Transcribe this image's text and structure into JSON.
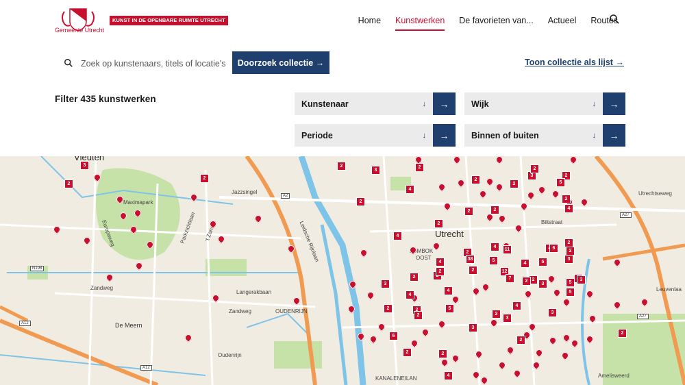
{
  "header": {
    "logo_text": "Gemeente Utrecht",
    "tagline": "KUNST IN DE OPENBARE RUIMTE UTRECHT",
    "nav": [
      {
        "label": "Home",
        "active": false
      },
      {
        "label": "Kunstwerken",
        "active": true
      },
      {
        "label": "De favorieten van...",
        "active": false
      },
      {
        "label": "Actueel",
        "active": false
      },
      {
        "label": "Routes",
        "active": false
      }
    ]
  },
  "search": {
    "placeholder": "Zoek op kunstenaars, titels of locatie's",
    "button_label": "Doorzoek collectie →",
    "list_link": "Toon collectie als lijst →"
  },
  "filters": {
    "title": "Filter 435 kunstwerken",
    "items": [
      {
        "label": "Kunstenaar"
      },
      {
        "label": "Wijk"
      },
      {
        "label": "Periode"
      },
      {
        "label": "Binnen of buiten"
      }
    ],
    "chevron": "↓",
    "go": "→"
  },
  "map": {
    "labels": {
      "vleuten": "Vleuten",
      "utrecht": "Utrecht",
      "demeern": "De Meern",
      "oudenrijn_caps": "OUDENRIJN",
      "oudenrijn": "Oudenrijn",
      "maximapark": "Maximapark",
      "lombok": "LOMBOK",
      "oost": "OOST",
      "kanaleneiland": "KANALENEILAN",
      "amelisweerd": "Amelisweerd",
      "leuvenlaan": "Leuvenlaa",
      "utrechtseweg": "Utrechtseweg",
      "biltstraat": "Biltstraat",
      "langerakbaan": "Langerakbaan",
      "zandweg": "Zandweg",
      "europaweg": "Europaweg",
      "parkzichtlaan": "Parkzichtlaan",
      "leidschrijnlaan": "Leidsche Rijnlaan",
      "jazzsingel": "Jazzsingel",
      "lalendorp": "'t Zand",
      "a2": "A2",
      "a12": "A12",
      "a27": "A27",
      "n198": "N198"
    },
    "clusters": [
      "3",
      "2",
      "2",
      "3",
      "2",
      "2",
      "2",
      "4",
      "2",
      "2",
      "4",
      "3",
      "2",
      "4",
      "2",
      "4",
      "3",
      "2",
      "2",
      "3",
      "2",
      "5",
      "2",
      "2",
      "2",
      "4",
      "38",
      "5",
      "12",
      "4",
      "2",
      "11",
      "4",
      "5",
      "2",
      "6",
      "2",
      "7",
      "3",
      "3",
      "4",
      "5",
      "2",
      "2",
      "3",
      "2",
      "2",
      "4",
      "2",
      "6",
      "2",
      "5",
      "2",
      "2",
      "4",
      "2",
      "2",
      "2",
      "2",
      "3",
      "3",
      "3",
      "5",
      "4"
    ],
    "colors": {
      "pin": "#c8102e",
      "water": "#7ec3e8",
      "green": "#c7e2a8",
      "road": "#ffffff",
      "highway": "#f19b52"
    }
  }
}
